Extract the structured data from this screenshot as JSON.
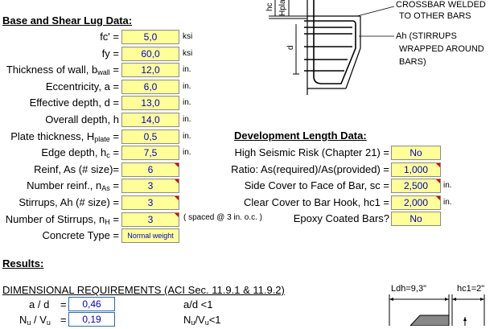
{
  "sections": {
    "base_title": "Base and Shear Lug Data:",
    "dev_title": "Development Length Data:",
    "results_title": "Results:",
    "dimensional": "DIMENSIONAL REQUIREMENTS (ACI Sec. 11.9.1 & 11.9.2)"
  },
  "base_inputs": [
    {
      "label": "fc' =",
      "value": "5,0",
      "unit": "ksi"
    },
    {
      "label": "fy =",
      "value": "60,0",
      "unit": "ksi"
    },
    {
      "label_pre": "Thickness of wall, b",
      "label_sub": "wall",
      "label_post": " =",
      "value": "12,0",
      "unit": "in."
    },
    {
      "label": "Eccentricity, a =",
      "value": "6,0",
      "unit": "in."
    },
    {
      "label": "Effective depth, d =",
      "value": "13,0",
      "unit": "in."
    },
    {
      "label": "Overall depth, h",
      "value": "14,0",
      "unit": "in."
    },
    {
      "label_pre": "Plate thickness, H",
      "label_sub": "plate",
      "label_post": " =",
      "value": "0,5",
      "unit": "in."
    },
    {
      "label_pre": "Edge depth, h",
      "label_sub": "c",
      "label_post": " =",
      "value": "7,5",
      "unit": "in."
    },
    {
      "label": "Reinf, As  (# size)=",
      "value": "6",
      "unit": ""
    },
    {
      "label_pre": "Number reinf., n",
      "label_sub": "As",
      "label_post": " =",
      "value": "3",
      "unit": ""
    },
    {
      "label": "Stirrups, Ah (# size) =",
      "value": "3",
      "unit": ""
    },
    {
      "label_pre": "Number of Stirrups, n",
      "label_sub": "H",
      "label_post": " =",
      "value": "3",
      "unit": ""
    },
    {
      "label": "Concrete Type =",
      "value": "Normal weight",
      "unit": ""
    }
  ],
  "spacing_note": "( spaced @ 3 in. o.c. )",
  "dev_inputs": [
    {
      "label": "High Seismic Risk (Chapter 21) =",
      "value": "No",
      "unit": ""
    },
    {
      "label": "Ratio: As(required)/As(provided) =",
      "value": "1,000",
      "unit": ""
    },
    {
      "label": "Side Cover to Face of Bar, sc =",
      "value": "2,500",
      "unit": "in."
    },
    {
      "label": "Clear Cover to Bar Hook, hc1 =",
      "value": "2,000",
      "unit": "in."
    },
    {
      "label": "Epoxy Coated Bars?",
      "value": "No",
      "unit": ""
    }
  ],
  "results": [
    {
      "label": "a / d",
      "eq": "=",
      "value": "0,46",
      "check": "a/d <1"
    },
    {
      "label_pre": "N",
      "label_sub": "u",
      "label_mid": " / V",
      "label_sub2": "u",
      "eq": "=",
      "value": "0,19",
      "check_pre": "N",
      "check_sub": "u",
      "check_mid": "/V",
      "check_sub2": "u",
      "check_post": "<1"
    }
  ],
  "diagram": {
    "note1a": "CROSSBAR WELDED",
    "note1b": "TO OTHER BARS",
    "note2a": "Ah (STIRRUPS",
    "note2b": "WRAPPED AROUND",
    "note2c": "BARS)",
    "hc": "hc",
    "hplate": "Hplate",
    "d": "d",
    "ldh": "Ldh=9,3\"",
    "hc1": "hc1=2\""
  }
}
